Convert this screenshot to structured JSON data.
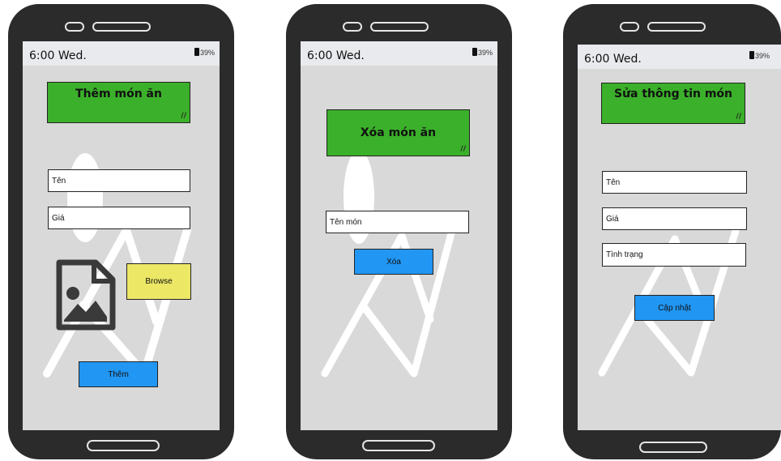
{
  "status_bar": {
    "time": "6:00 Wed.",
    "battery": "39%"
  },
  "colors": {
    "title_bg": "#3bb02a",
    "primary_button": "#2196f3",
    "browse_button": "#ece765",
    "screen_bg": "#d9d9d9",
    "device": "#2b2b2b"
  },
  "screens": [
    {
      "title": "Thêm món ăn",
      "fields": [
        "Tên",
        "Giá"
      ],
      "image_placeholder_icon": "image-file-icon",
      "browse_label": "Browse",
      "submit_label": "Thêm"
    },
    {
      "title": "Xóa món ăn",
      "fields": [
        "Tên món"
      ],
      "submit_label": "Xóa"
    },
    {
      "title": "Sửa thông tin món",
      "fields": [
        "Tên",
        "Giá",
        "Tình trạng"
      ],
      "submit_label": "Cập nhật"
    }
  ]
}
